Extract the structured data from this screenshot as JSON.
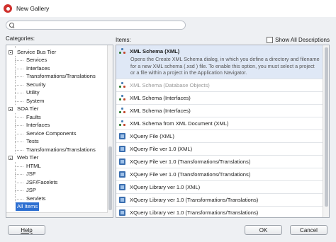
{
  "window": {
    "title": "New Gallery"
  },
  "search": {
    "placeholder": ""
  },
  "categories": {
    "header": "Categories:",
    "items": [
      {
        "label": "Service Bus Tier",
        "level": 0,
        "toggle": true
      },
      {
        "label": "Services",
        "level": 1
      },
      {
        "label": "Interfaces",
        "level": 1
      },
      {
        "label": "Transformations/Translations",
        "level": 1
      },
      {
        "label": "Security",
        "level": 1
      },
      {
        "label": "Utility",
        "level": 1
      },
      {
        "label": "System",
        "level": 1
      },
      {
        "label": "SOA Tier",
        "level": 0,
        "toggle": true
      },
      {
        "label": "Faults",
        "level": 1
      },
      {
        "label": "Interfaces",
        "level": 1
      },
      {
        "label": "Service Components",
        "level": 1
      },
      {
        "label": "Tests",
        "level": 1
      },
      {
        "label": "Transformations/Translations",
        "level": 1
      },
      {
        "label": "Web Tier",
        "level": 0,
        "toggle": true
      },
      {
        "label": "HTML",
        "level": 1
      },
      {
        "label": "JSF",
        "level": 1
      },
      {
        "label": "JSF/Facelets",
        "level": 1
      },
      {
        "label": "JSP",
        "level": 1
      },
      {
        "label": "Servlets",
        "level": 1
      },
      {
        "label": "All Items",
        "level": 0,
        "selected": true
      }
    ]
  },
  "items": {
    "header": "Items:",
    "show_all_label": "Show All Descriptions",
    "entries": [
      {
        "name": "XML Schema (XML)",
        "icon": "xml-schema-icon",
        "selected": true,
        "description": "Opens the Create XML Schema dialog, in which you define a directory and filename for a new XML schema (.xsd ) file. To enable this option, you must select a project or a file within a project in the Application Navigator."
      },
      {
        "name": "XML Schema (Database Objects)",
        "icon": "xml-schema-icon",
        "disabled": true
      },
      {
        "name": "XML Schema (Interfaces)",
        "icon": "xml-schema-icon"
      },
      {
        "name": "XML Schema (Interfaces)",
        "icon": "xml-schema-icon"
      },
      {
        "name": "XML Schema from XML Document (XML)",
        "icon": "xml-schema-icon"
      },
      {
        "name": "XQuery File (XML)",
        "icon": "xquery-icon"
      },
      {
        "name": "XQuery File ver 1.0 (XML)",
        "icon": "xquery-icon"
      },
      {
        "name": "XQuery File ver 1.0 (Transformations/Translations)",
        "icon": "xquery-icon"
      },
      {
        "name": "XQuery File ver 1.0 (Transformations/Translations)",
        "icon": "xquery-icon"
      },
      {
        "name": "XQuery Library ver 1.0 (XML)",
        "icon": "xquery-icon"
      },
      {
        "name": "XQuery Library ver 1.0 (Transformations/Translations)",
        "icon": "xquery-icon"
      },
      {
        "name": "XQuery Library ver 1.0 (Transformations/Translations)",
        "icon": "xquery-icon"
      }
    ]
  },
  "buttons": {
    "help": "Help",
    "ok": "OK",
    "cancel": "Cancel"
  }
}
